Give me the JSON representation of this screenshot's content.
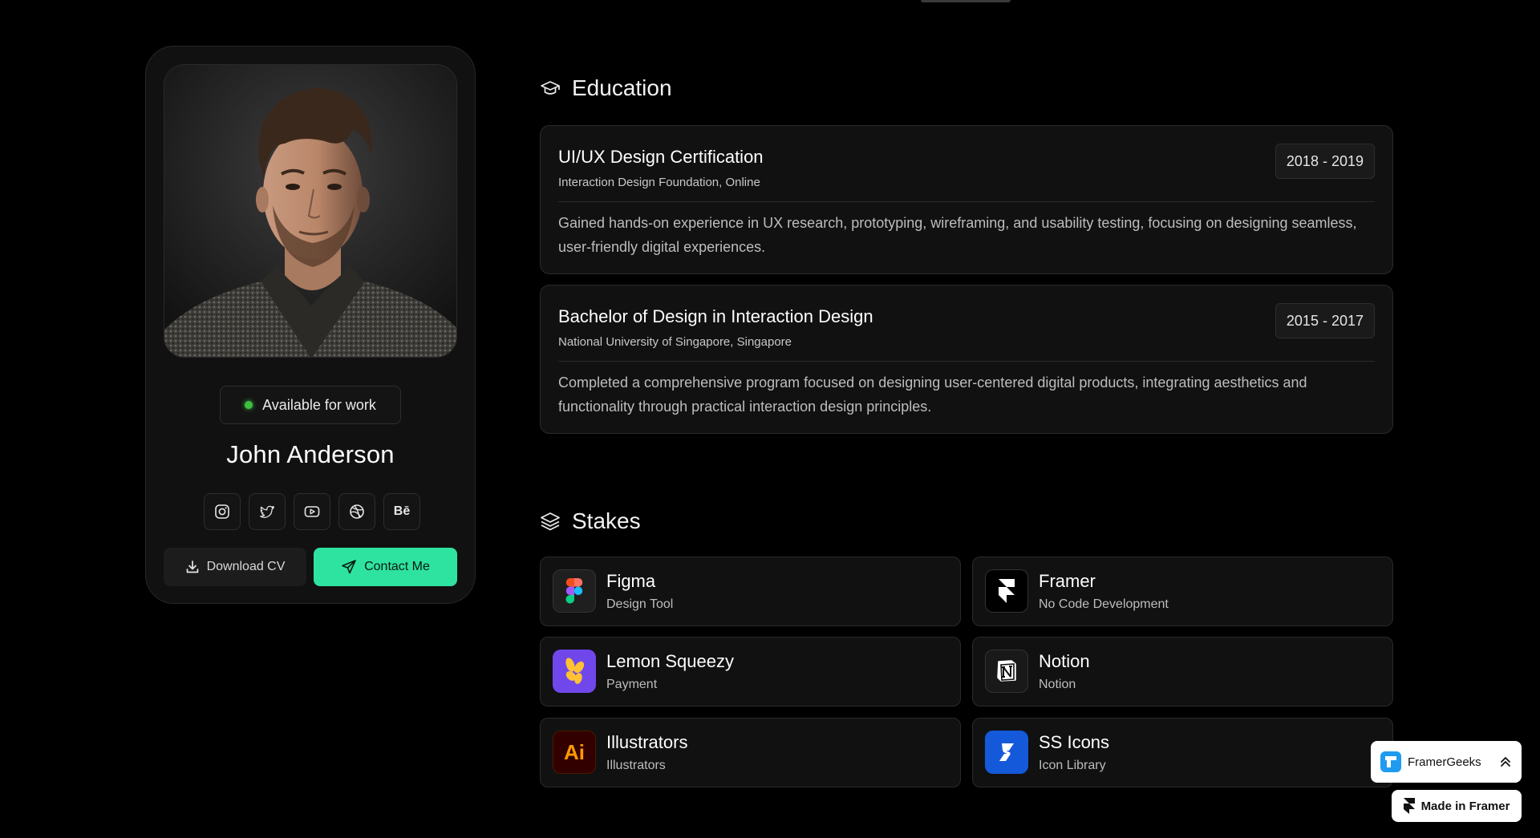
{
  "profile": {
    "status": "Available for work",
    "name": "John Anderson",
    "socials": [
      "instagram",
      "twitter",
      "youtube",
      "dribbble",
      "behance"
    ],
    "behance_label": "Bē",
    "download_label": "Download CV",
    "contact_label": "Contact Me"
  },
  "education": {
    "title": "Education",
    "items": [
      {
        "degree": "UI/UX Design Certification",
        "institution": "Interaction Design Foundation, Online",
        "years": "2018 - 2019",
        "description": "Gained hands-on experience in UX research, prototyping, wireframing, and usability testing, focusing on designing seamless, user-friendly digital experiences."
      },
      {
        "degree": "Bachelor of Design in Interaction Design",
        "institution": "National University of Singapore, Singapore",
        "years": "2015 - 2017",
        "description": "Completed a comprehensive program focused on designing user-centered digital products, integrating aesthetics and functionality through practical interaction design principles."
      }
    ]
  },
  "stakes": {
    "title": "Stakes",
    "items": [
      {
        "name": "Figma",
        "subtitle": "Design Tool",
        "icon": "figma-icon"
      },
      {
        "name": "Framer",
        "subtitle": "No Code Development",
        "icon": "framer-icon"
      },
      {
        "name": "Lemon Squeezy",
        "subtitle": "Payment",
        "icon": "lemon-squeezy-icon"
      },
      {
        "name": "Notion",
        "subtitle": "Notion",
        "icon": "notion-icon"
      },
      {
        "name": "Illustrators",
        "subtitle": "Illustrators",
        "icon": "illustrator-icon",
        "logo_text": "Ai"
      },
      {
        "name": "SS Icons",
        "subtitle": "Icon Library",
        "icon": "ss-icons-icon"
      }
    ]
  },
  "badges": {
    "framergeeks": "FramerGeeks",
    "made_in_framer": "Made in Framer"
  },
  "colors": {
    "accent": "#2ee3a0",
    "status_dot": "#3fbf3f",
    "background": "#000000",
    "card": "#111111"
  }
}
